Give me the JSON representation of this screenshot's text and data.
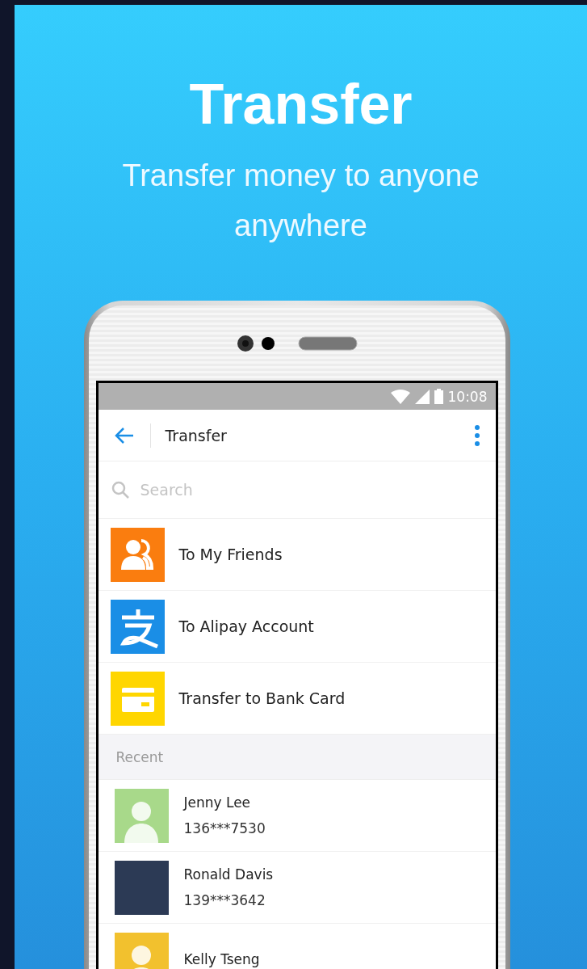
{
  "headline": {
    "title": "Transfer",
    "subtitle": "Transfer money to anyone anywhere"
  },
  "status_bar": {
    "time": "10:08"
  },
  "app_bar": {
    "title": "Transfer"
  },
  "search": {
    "placeholder": "Search"
  },
  "options": [
    {
      "kind": "friends",
      "label": "To My Friends"
    },
    {
      "kind": "alipay",
      "label": "To Alipay Account"
    },
    {
      "kind": "card",
      "label": "Transfer to Bank Card"
    }
  ],
  "recent": {
    "header": "Recent",
    "contacts": [
      {
        "kind": "illustration",
        "color": "#a8d98a",
        "name": "Jenny Lee",
        "phone": "136***7530"
      },
      {
        "kind": "photo",
        "color": "#2c3a55",
        "name": "Ronald Davis",
        "phone": "139***3642"
      },
      {
        "kind": "illustration",
        "color": "#f2c12e",
        "name": "Kelly Tseng"
      }
    ]
  }
}
